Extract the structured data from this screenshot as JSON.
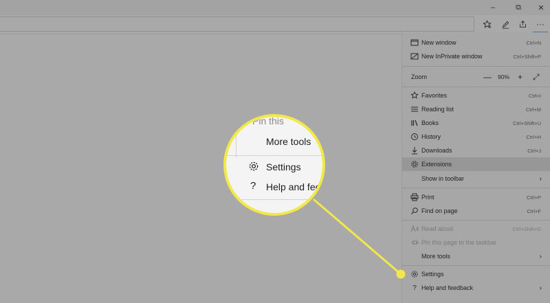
{
  "window_controls": {
    "minimize": "–",
    "restore": "⧉",
    "close": "✕"
  },
  "toolbar": {
    "favorites_icon": "favorites-star-icon",
    "notes_icon": "pen-icon",
    "share_icon": "share-icon",
    "more_label": "···"
  },
  "menu": {
    "items": [
      {
        "label": "New window",
        "shortcut": "Ctrl+N",
        "icon": "window-icon"
      },
      {
        "label": "New InPrivate window",
        "shortcut": "Ctrl+Shift+P",
        "icon": "inprivate-icon"
      },
      {
        "label": "Favorites",
        "shortcut": "Ctrl+I",
        "icon": "favorites-star-icon"
      },
      {
        "label": "Reading list",
        "shortcut": "Ctrl+M",
        "icon": "reading-list-icon"
      },
      {
        "label": "Books",
        "shortcut": "Ctrl+Shift+U",
        "icon": "books-icon"
      },
      {
        "label": "History",
        "shortcut": "Ctrl+H",
        "icon": "history-icon"
      },
      {
        "label": "Downloads",
        "shortcut": "Ctrl+J",
        "icon": "download-icon"
      },
      {
        "label": "Extensions",
        "icon": "extensions-icon"
      },
      {
        "label": "Show in toolbar",
        "chevron": "›"
      },
      {
        "label": "Print",
        "shortcut": "Ctrl+P",
        "icon": "print-icon"
      },
      {
        "label": "Find on page",
        "shortcut": "Ctrl+F",
        "icon": "search-icon"
      },
      {
        "label": "Read aloud",
        "shortcut": "Ctrl+Shift+G",
        "icon": "read-aloud-icon"
      },
      {
        "label": "Pin this page to the taskbar",
        "icon": "pin-icon"
      },
      {
        "label": "More tools",
        "chevron": "›"
      },
      {
        "label": "Settings",
        "icon": "gear-icon"
      },
      {
        "label": "Help and feedback",
        "icon": "help-icon",
        "chevron": "›"
      }
    ],
    "zoom": {
      "label": "Zoom",
      "minus": "—",
      "value": "90%",
      "plus": "+",
      "fullscreen": "⤢"
    }
  },
  "magnifier": {
    "pin_text": "Pin this",
    "more_tools": "More tools",
    "settings": "Settings",
    "help": "Help and fee"
  },
  "colors": {
    "highlight_ring": "#f2e84a",
    "menu_bg": "#a7a7a7",
    "backdrop": "#a9a9a9"
  }
}
